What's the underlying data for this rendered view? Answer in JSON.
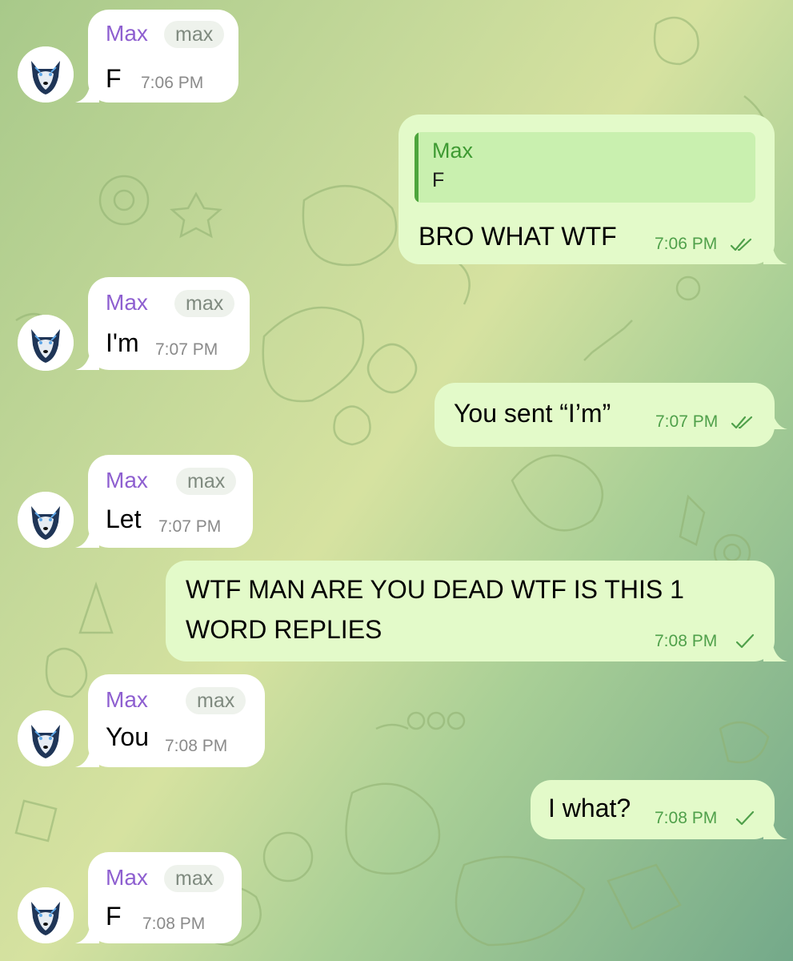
{
  "colors": {
    "incoming_bubble": "#ffffff",
    "outgoing_bubble": "#e3fac9",
    "sender_name": "#8e5fd0",
    "outgoing_time": "#4fa04a",
    "quote_accent": "#4da53c"
  },
  "icons": {
    "avatar": "husky-wolf-avatar",
    "read_receipt": "double-check-icon",
    "sent_receipt": "single-check-icon"
  },
  "messages": [
    {
      "direction": "in",
      "sender": "Max",
      "tag": "max",
      "text": "F",
      "time": "7:06 PM"
    },
    {
      "direction": "out",
      "reply_to": {
        "name": "Max",
        "text": "F"
      },
      "text": "BRO WHAT WTF",
      "time": "7:06 PM",
      "status": "read"
    },
    {
      "direction": "in",
      "sender": "Max",
      "tag": "max",
      "text": "I'm",
      "time": "7:07 PM"
    },
    {
      "direction": "out",
      "text": "You sent “I’m”",
      "time": "7:07 PM",
      "status": "read"
    },
    {
      "direction": "in",
      "sender": "Max",
      "tag": "max",
      "text": "Let",
      "time": "7:07 PM"
    },
    {
      "direction": "out",
      "text_lines": [
        "WTF MAN ARE YOU DEAD WTF IS THIS 1",
        "WORD REPLIES"
      ],
      "time": "7:08 PM",
      "status": "sent"
    },
    {
      "direction": "in",
      "sender": "Max",
      "tag": "max",
      "text": "You",
      "time": "7:08 PM"
    },
    {
      "direction": "out",
      "text": "I what?",
      "time": "7:08 PM",
      "status": "sent"
    },
    {
      "direction": "in",
      "sender": "Max",
      "tag": "max",
      "text": "F",
      "time": "7:08 PM"
    }
  ]
}
